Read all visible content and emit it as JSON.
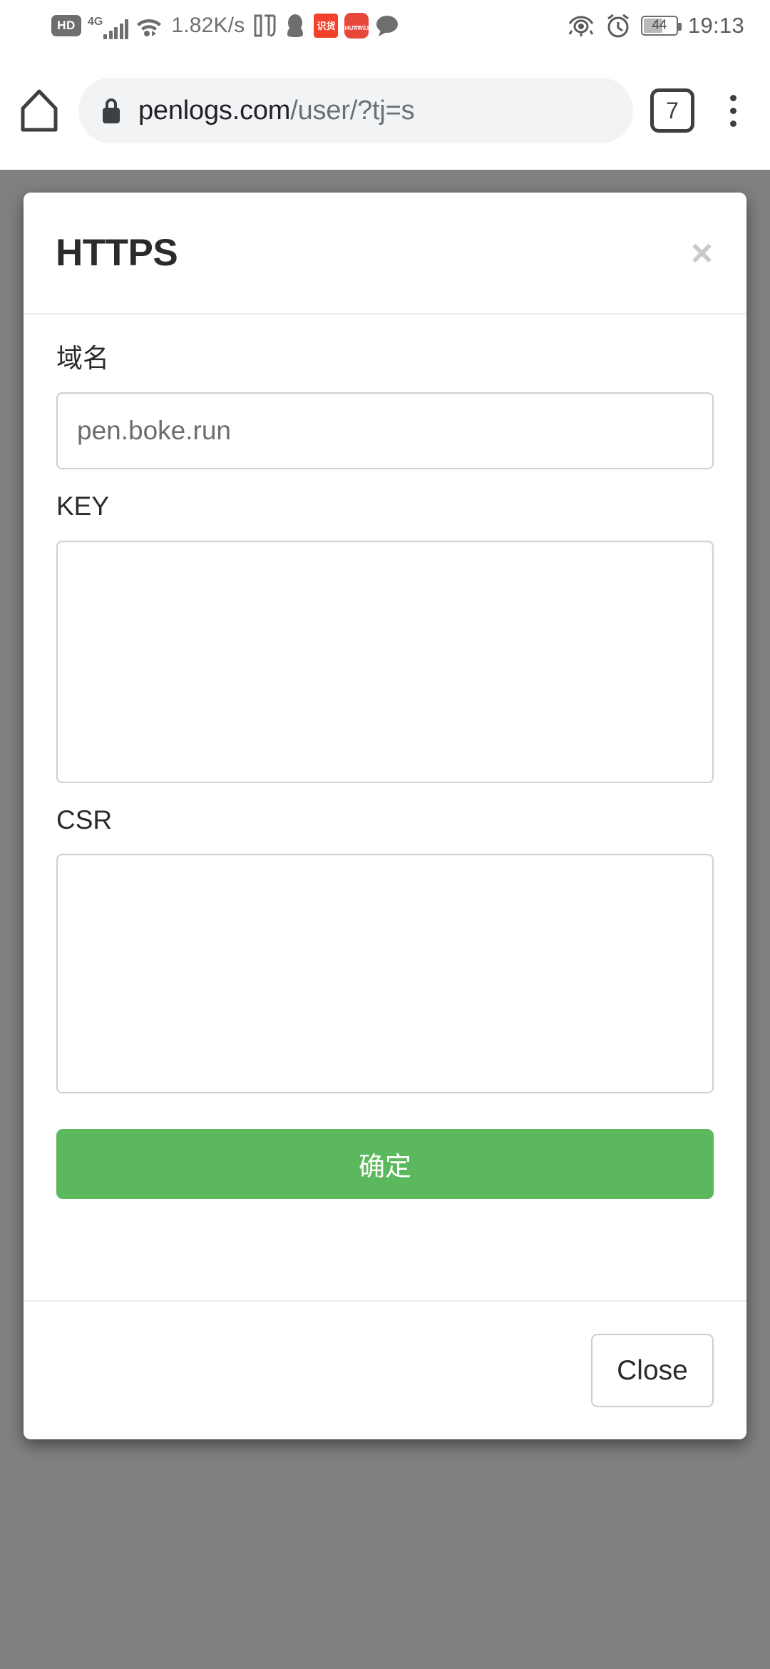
{
  "statusbar": {
    "hd_label": "HD",
    "network_type": "4G",
    "signal_icon": "signal-bars-icon",
    "wifi_icon": "wifi-icon",
    "network_speed": "1.82K/s",
    "app_icons": [
      {
        "name": "ting-app-icon",
        "label": "听"
      },
      {
        "name": "qq-penguin-icon",
        "label": ""
      },
      {
        "name": "shihuo-app-icon",
        "label": "识货"
      },
      {
        "name": "huawei-app-icon",
        "label": "HUAWEI"
      },
      {
        "name": "message-bubble-icon",
        "label": ""
      }
    ],
    "eye_comfort_icon": "eye-icon",
    "alarm_icon": "alarm-clock-icon",
    "battery_level": "44",
    "clock": "19:13"
  },
  "browser": {
    "home_icon": "home-icon",
    "lock_icon": "lock-icon",
    "url_secure": "penlogs.com",
    "url_path": "/user/?tj=s",
    "tab_count": "7",
    "menu_icon": "overflow-menu-icon"
  },
  "modal": {
    "title": "HTTPS",
    "close_x": "×",
    "fields": {
      "domain": {
        "label": "域名",
        "value": "pen.boke.run",
        "placeholder": "pen.boke.run"
      },
      "key": {
        "label": "KEY",
        "value": "",
        "placeholder": ""
      },
      "csr": {
        "label": "CSR",
        "value": "",
        "placeholder": ""
      }
    },
    "submit_label": "确定",
    "close_label": "Close"
  },
  "colors": {
    "accent_green": "#5cb85c",
    "overlay": "#808080",
    "border": "#cfd2d4",
    "text": "#2b2b2b"
  }
}
